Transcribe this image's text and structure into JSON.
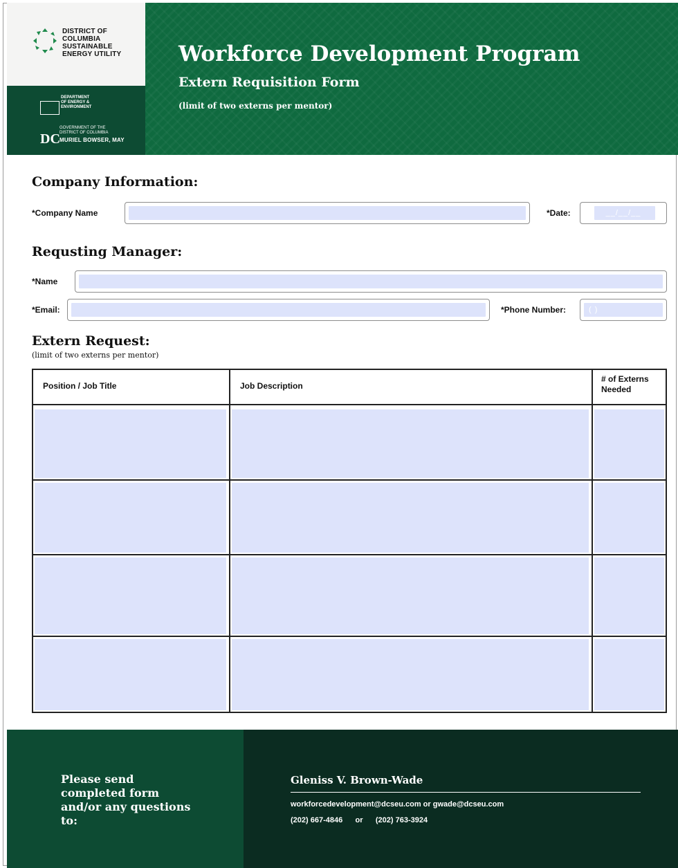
{
  "header": {
    "org_logo_text": [
      "DISTRICT OF",
      "COLUMBIA",
      "SUSTAINABLE",
      "ENERGY UTILITY"
    ],
    "doee_logo_text": [
      "DEPARTMENT",
      "OF ENERGY &",
      "ENVIRONMENT"
    ],
    "dc_gov_text": [
      "GOVERNMENT OF THE",
      "DISTRICT OF COLUMBIA"
    ],
    "dc_mark": "DC",
    "dc_mayor": "MURIEL BOWSER, MAY",
    "title": "Workforce Development Program",
    "subtitle": "Extern Requisition Form",
    "note": "(limit of two externs per mentor)",
    "colors": {
      "banner": "#0f6a3f",
      "dark_green": "#0d4b33",
      "field_fill": "#dde3fb"
    }
  },
  "company": {
    "section_title": "Company Information:",
    "company_name_label": "*Company Name",
    "company_name_value": "",
    "date_label": "*Date:",
    "date_mask": "__/__/__"
  },
  "manager": {
    "section_title": "Requsting Manager:",
    "name_label": "*Name",
    "name_value": "",
    "email_label": "*Email:",
    "email_value": "",
    "phone_label": "*Phone Number:",
    "phone_mask": "(     )"
  },
  "request": {
    "section_title": "Extern Request:",
    "note": "(limit of two externs per mentor)",
    "columns": [
      "Position / Job Title",
      "Job Description",
      "# of Externs Needed"
    ],
    "rows": [
      [
        "",
        "",
        ""
      ],
      [
        "",
        "",
        ""
      ],
      [
        "",
        "",
        ""
      ],
      [
        "",
        "",
        ""
      ]
    ]
  },
  "footer": {
    "message": "Please send completed form and/or any questions to:",
    "contact_name": "Gleniss V. Brown-Wade",
    "emails": "workforcedevelopment@dcseu.com or gwade@dcseu.com",
    "phones": "(202) 667-4846      or      (202) 763-3924"
  }
}
